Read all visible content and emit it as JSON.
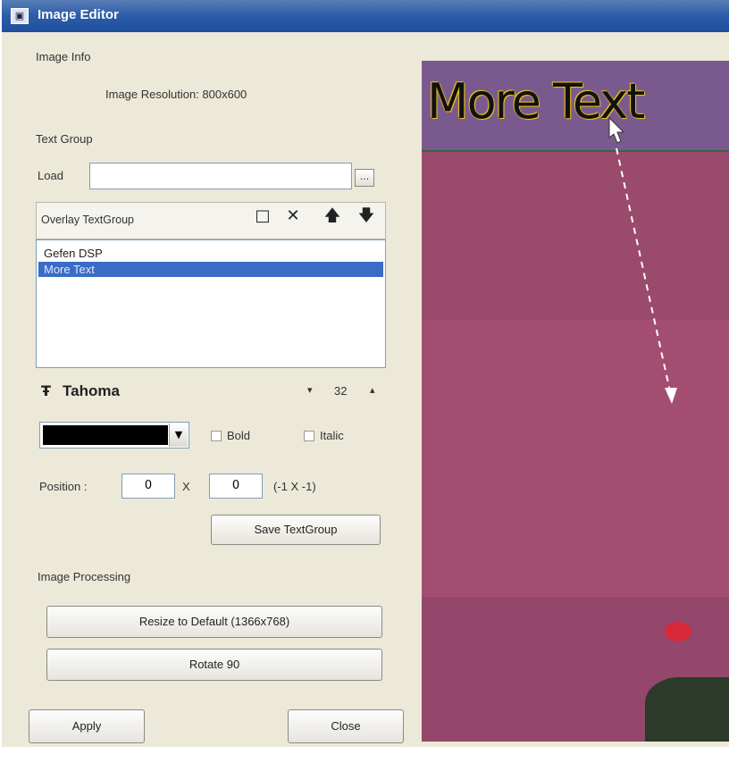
{
  "window": {
    "title": "Image Editor",
    "icon": "image-editor-icon"
  },
  "image_info": {
    "section_label": "Image Info",
    "resolution_label": "Image Resolution: 800x600"
  },
  "text_group": {
    "section_label": "Text Group",
    "load_label": "Load",
    "load_value": "",
    "browse_label": "...",
    "list_header": "Overlay TextGroup",
    "toolbar_icons": [
      "new-icon",
      "delete-icon",
      "move-up-icon",
      "move-down-icon"
    ],
    "items": [
      {
        "label": "Gefen DSP",
        "selected": false
      },
      {
        "label": "More Text",
        "selected": true
      }
    ]
  },
  "font": {
    "name": "Tahoma",
    "size": "32",
    "color": "#000000",
    "bold_label": "Bold",
    "italic_label": "Italic",
    "bold_checked": false,
    "italic_checked": false
  },
  "position": {
    "label": "Position :",
    "x": "0",
    "separator": "X",
    "y": "0",
    "hint": "(-1 X -1)"
  },
  "buttons": {
    "save_text_group": "Save TextGroup",
    "resize_default": "Resize to Default (1366x768)",
    "rotate": "Rotate 90",
    "apply": "Apply",
    "close": "Close"
  },
  "image_processing": {
    "section_label": "Image Processing"
  },
  "preview": {
    "overlay_text": "More Text",
    "background_color": "#9b4a6c",
    "text_color": "#111111",
    "outline_color": "#e8c21a"
  }
}
